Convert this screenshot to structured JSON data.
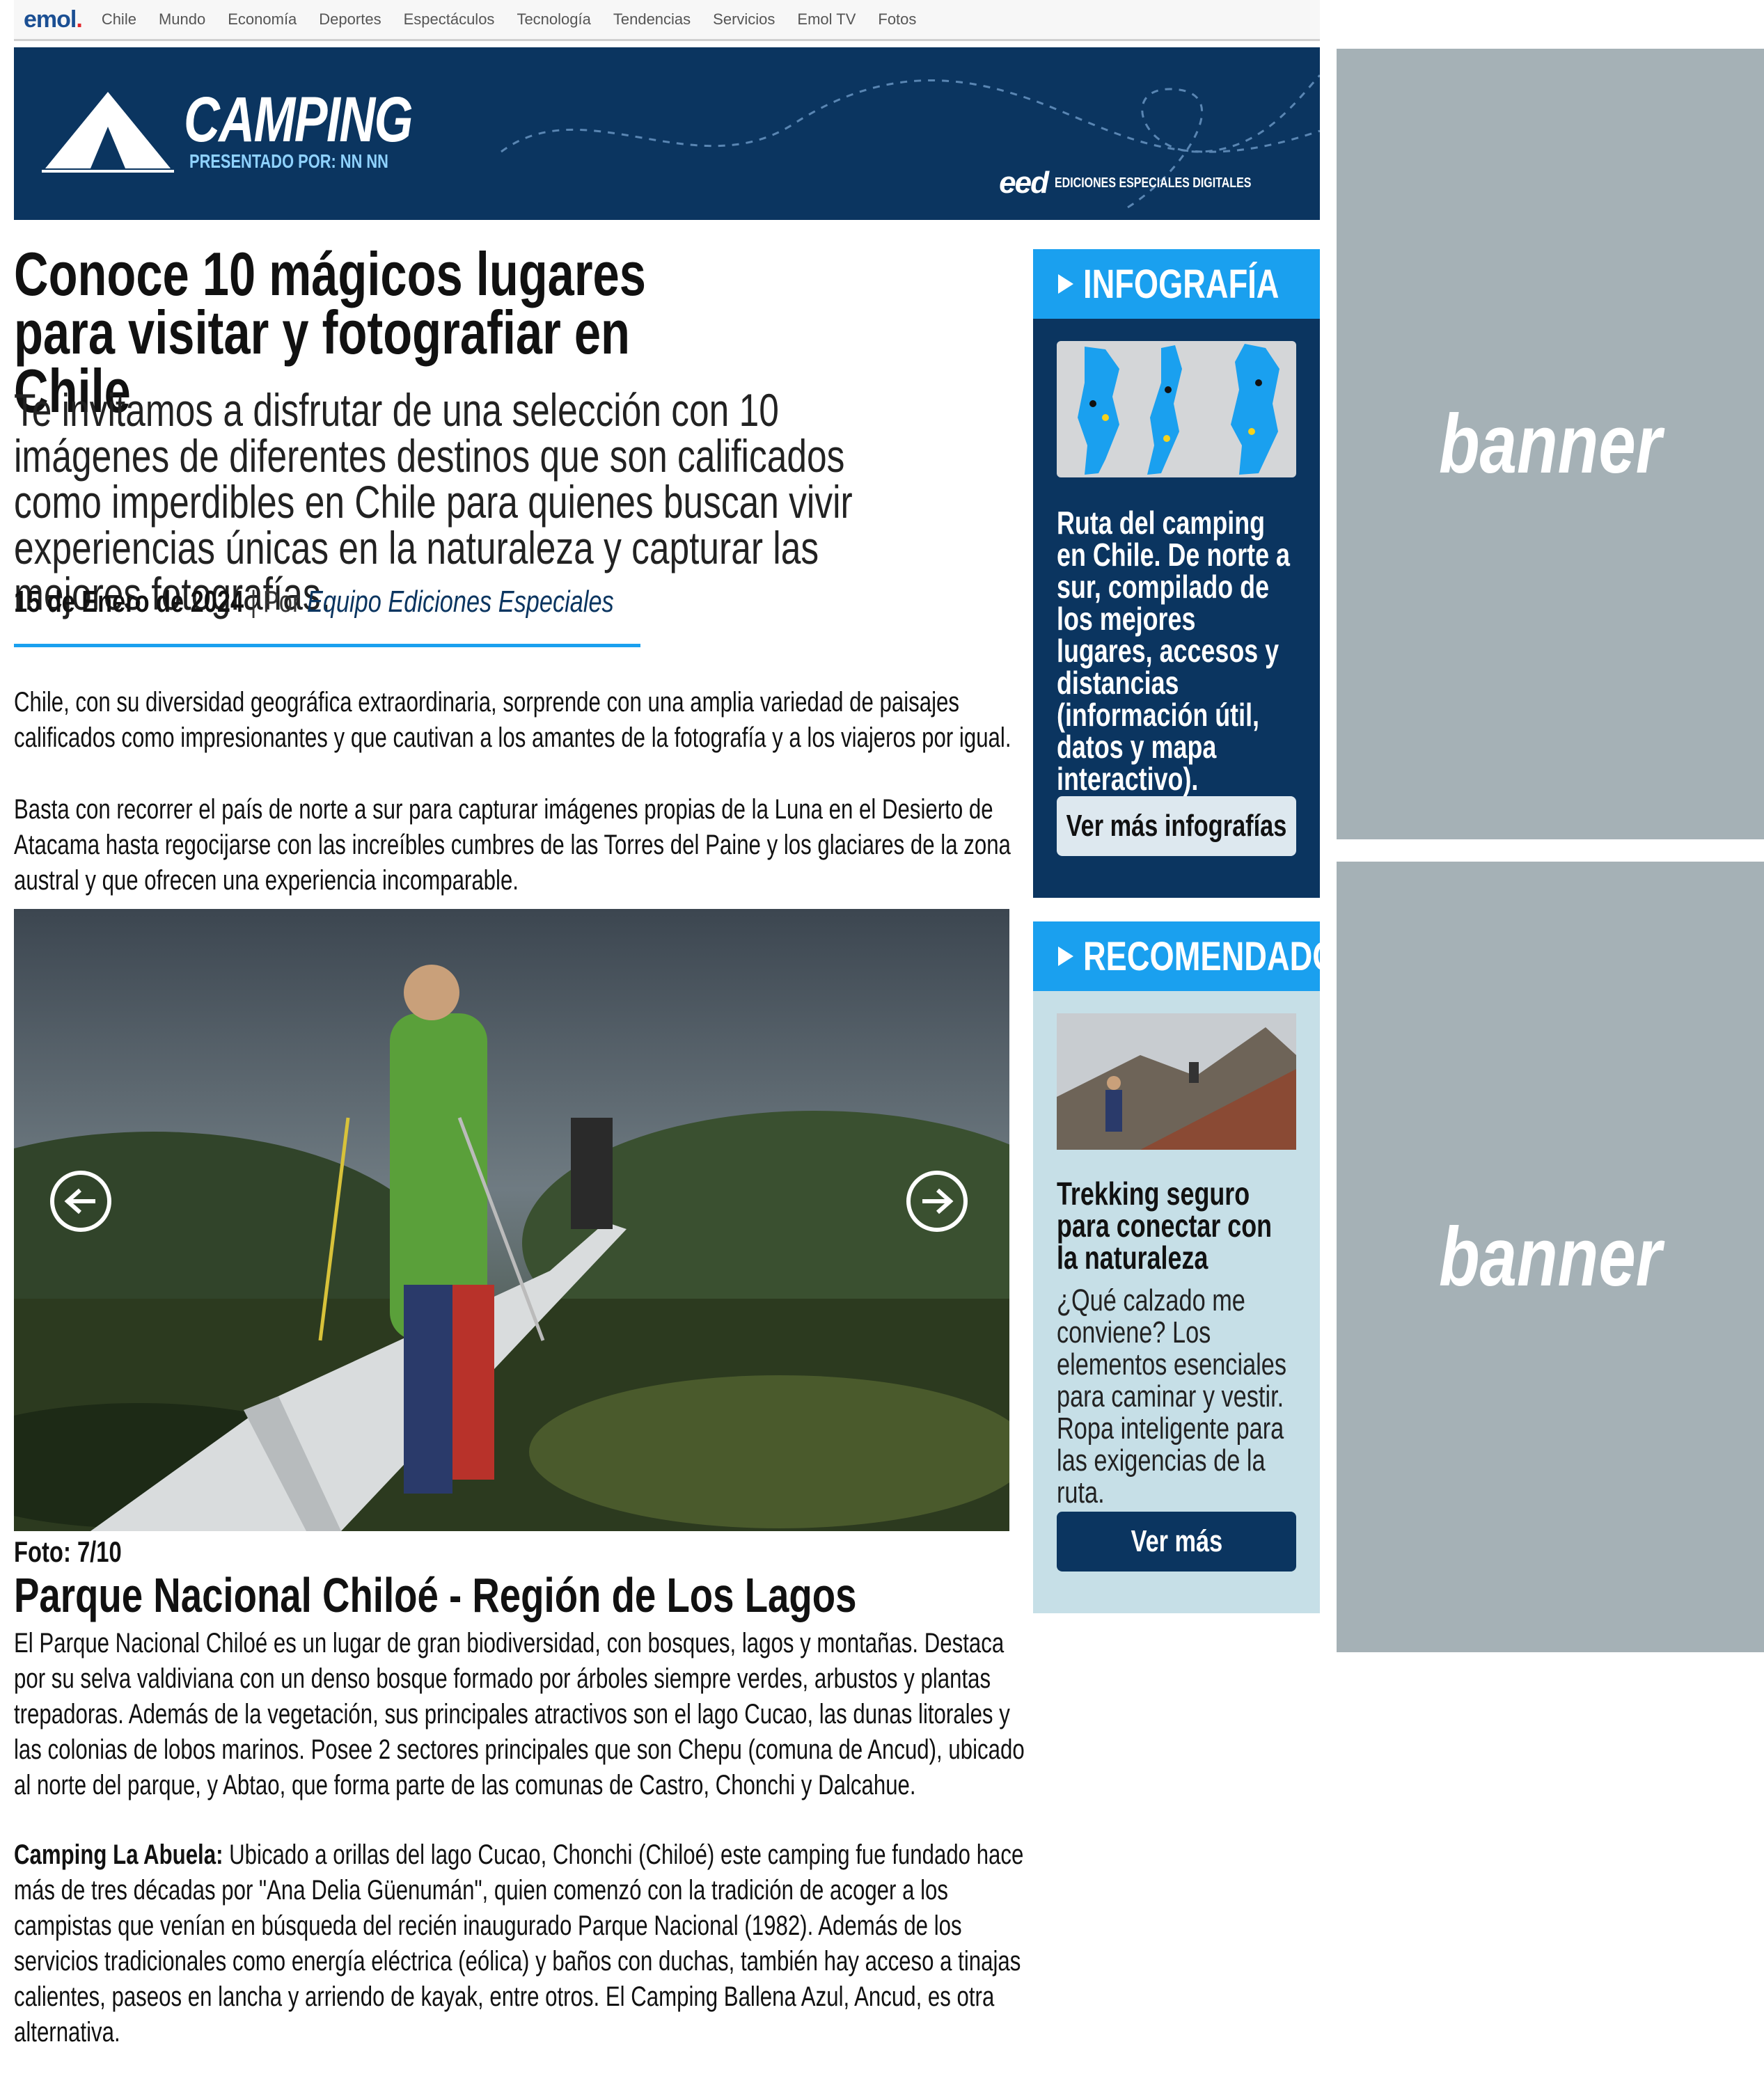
{
  "nav": {
    "logo": "emol",
    "logo_dot": ".",
    "links": [
      "Chile",
      "Mundo",
      "Economía",
      "Deportes",
      "Espectáculos",
      "Tecnología",
      "Tendencias",
      "Servicios",
      "Emol TV",
      "Fotos"
    ]
  },
  "hero": {
    "title": "CAMPING",
    "subtitle": "PRESENTADO POR: NN NN",
    "eed_logo": "eed",
    "eed_label": "EDICIONES ESPECIALES DIGITALES"
  },
  "article": {
    "headline": "Conoce 10 mágicos lugares para visitar y fotografiar en Chile",
    "deck": "Te invitamos a disfrutar de una selección con 10 imágenes de diferentes destinos que son calificados como imperdibles en Chile para quienes buscan vivir experiencias únicas en la naturaleza y capturar las mejores fotografías.",
    "date": "15 de Enero de 2024",
    "by_separator": "| Por",
    "author": "Equipo Ediciones Especiales",
    "intro_1": "Chile, con su diversidad geográfica extraordinaria, sorprende con una amplia variedad de paisajes calificados como impresionantes y que cautivan a los amantes de la fotografía y a los viajeros por igual.",
    "intro_2": "Basta con recorrer el país de norte a sur para capturar imágenes propias de la Luna en el Desierto de Atacama hasta regocijarse con las increíbles cumbres de las Torres del Paine y los glaciares de la zona austral y que ofrecen una experiencia incomparable."
  },
  "gallery": {
    "counter": "Foto: 7/10",
    "title": "Parque Nacional Chiloé - Región de Los Lagos",
    "description": "El Parque Nacional Chiloé es un lugar de gran biodiversidad, con bosques, lagos y montañas. Destaca por su selva valdiviana con un denso bosque formado por árboles siempre verdes, arbustos y plantas trepadoras. Además de la vegetación, sus principales atractivos son el lago Cucao, las dunas litorales y las colonias de lobos marinos. Posee 2 sectores principales que son Chepu (comuna de Ancud), ubicado al norte del parque, y Abtao, que forma parte de las comunas de Castro, Chonchi y Dalcahue.",
    "camping_label": "Camping La Abuela:",
    "camping_text": " Ubicado a orillas del lago Cucao, Chonchi (Chiloé) este camping fue fundado hace más de tres décadas por \"Ana Delia Güenumán\", quien comenzó con la tradición de acoger a los campistas que venían en búsqueda del recién inaugurado Parque Nacional (1982). Además de los servicios tradicionales como energía eléctrica (eólica) y baños con duchas, también hay acceso a tinajas calientes, paseos en lancha y arriendo de kayak, entre otros. El Camping Ballena Azul, Ancud, es otra alternativa.",
    "prev_icon": "arrow-left-icon",
    "next_icon": "arrow-right-icon"
  },
  "sidebar": {
    "infografia": {
      "heading": "INFOGRAFÍA",
      "text": "Ruta del camping en Chile. De norte a sur, compilado de los mejores lugares, accesos y distancias (información útil, datos y mapa interactivo).",
      "button": "Ver más infografías"
    },
    "recomendado": {
      "heading": "RECOMENDADO",
      "title": "Trekking seguro para conectar con la naturaleza",
      "text": "¿Qué calzado me conviene? Los elementos esenciales para caminar y vestir. Ropa inteligente para las exigencias de la ruta.",
      "button": "Ver más"
    }
  },
  "banners": [
    "banner",
    "banner"
  ],
  "colors": {
    "navy": "#0b3560",
    "accent_blue": "#1aa0ef",
    "recommend_bg": "#c6dfe7",
    "banner_gray": "#a5b1b6"
  }
}
